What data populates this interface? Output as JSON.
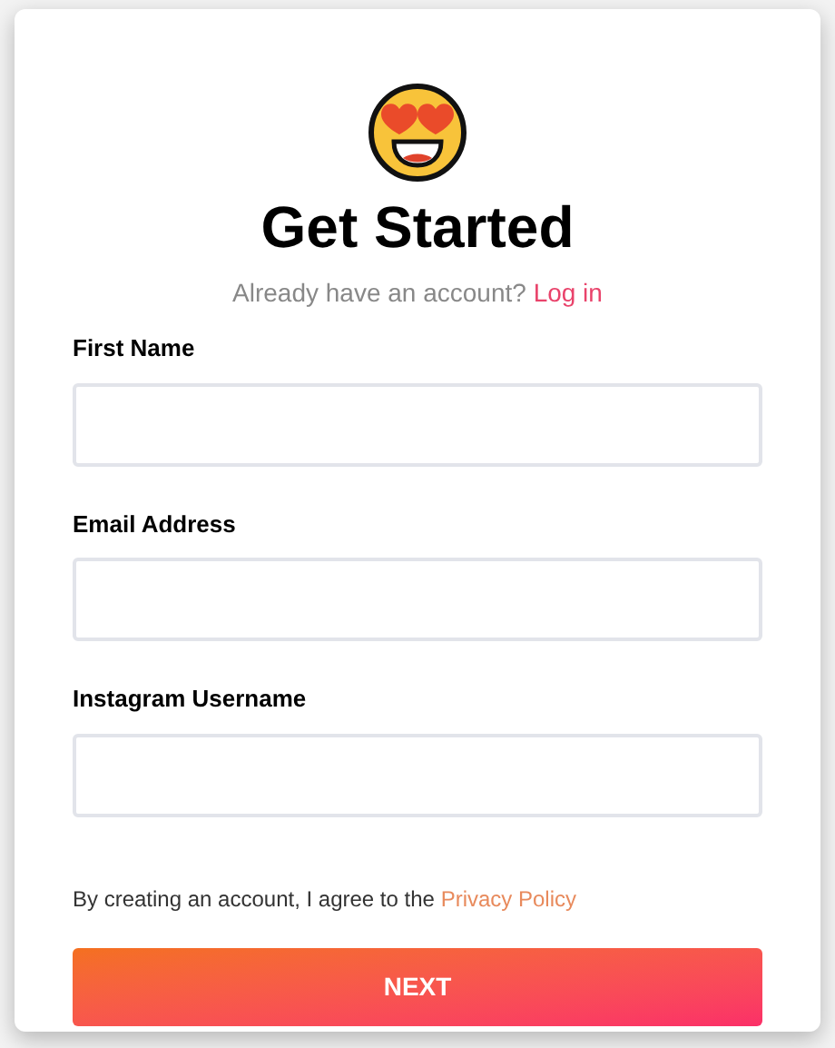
{
  "title": "Get Started",
  "login_prompt": {
    "text": "Already have an account?",
    "link": "Log in"
  },
  "fields": [
    {
      "label": "First Name"
    },
    {
      "label": "Email Address"
    },
    {
      "label": "Instagram Username"
    }
  ],
  "consent": {
    "text": "By creating an account, I agree to the",
    "link": "Privacy Policy"
  },
  "button": "NEXT"
}
